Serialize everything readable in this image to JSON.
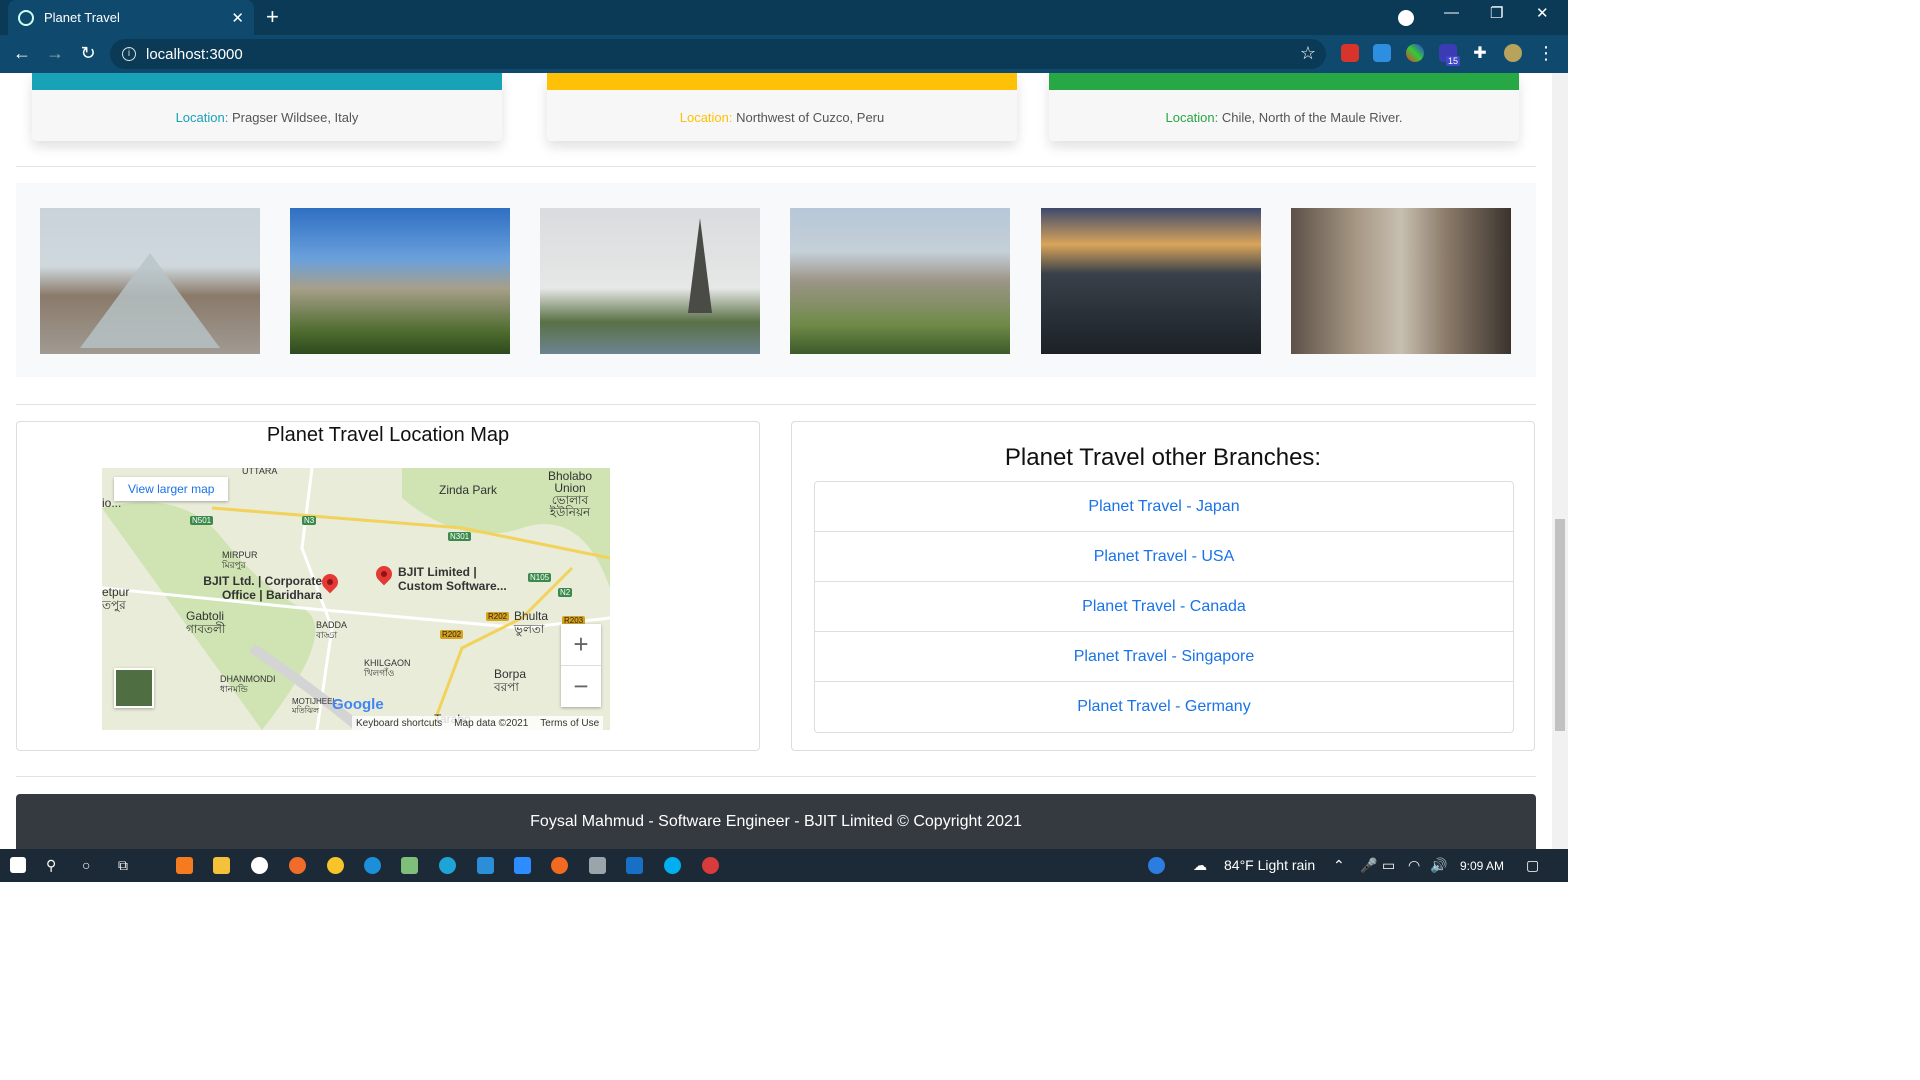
{
  "browser": {
    "tab_title": "Planet Travel",
    "tab_close": "✕",
    "new_tab": "+",
    "url": "localhost:3000",
    "win_min": "—",
    "win_max": "❐",
    "win_close": "✕",
    "ext_badge": "15"
  },
  "locations": [
    {
      "label": "Location:",
      "value": "Pragser Wildsee, Italy",
      "color": "#17a2b8"
    },
    {
      "label": "Location:",
      "value": "Northwest of Cuzco, Peru",
      "color": "#ffc107"
    },
    {
      "label": "Location:",
      "value": "Chile, North of the Maule River.",
      "color": "#28a745"
    }
  ],
  "gallery": [
    {
      "icon": "louvre-photo"
    },
    {
      "icon": "notre-dame-photo"
    },
    {
      "icon": "eiffel-tower-photo"
    },
    {
      "icon": "paris-aerial-photo"
    },
    {
      "icon": "city-night-photo"
    },
    {
      "icon": "paris-street-photo"
    }
  ],
  "map_panel": {
    "title": "Planet Travel Location Map",
    "view_larger": "View larger map",
    "labels": {
      "uttara": "UTTARA",
      "zinda_park": "Zinda Park",
      "bholabo": "Bholabo Union ভোলাব ইউনিয়ন",
      "mirpur": "MIRPUR মিরপুর",
      "bjit_corp": "BJIT Ltd. | Corporate Office | Baridhara",
      "bjit_ltd": "BJIT Limited | Custom Software...",
      "gabtoli": "Gabtoli গাবতলী",
      "badda": "BADDA বাড্ডা",
      "bhulta": "Bhulta ভুলতা",
      "khilgaon": "KHILGAON খিলগাঁও",
      "dhanmondi": "DHANMONDI ধানমন্ডি",
      "motijheel": "MOTIJHEEL মতিঝিল",
      "borpa": "Borpa বরপা",
      "tarabo": "Tarabo",
      "etpur": "etpur তপুর",
      "io": "io..."
    },
    "roads": [
      "N501",
      "N3",
      "N301",
      "N105",
      "N2",
      "R202",
      "R202",
      "R203"
    ],
    "google": "Google",
    "zoom_in": "+",
    "zoom_out": "−",
    "footer": [
      "Keyboard shortcuts",
      "Map data ©2021",
      "Terms of Use"
    ]
  },
  "branches": {
    "title": "Planet Travel other Branches:",
    "items": [
      "Planet Travel - Japan",
      "Planet Travel - USA",
      "Planet Travel - Canada",
      "Planet Travel - Singapore",
      "Planet Travel - Germany"
    ]
  },
  "footer": {
    "text": "Foysal Mahmud - Software Engineer - BJIT Limited © Copyright 2021"
  },
  "taskbar": {
    "weather": "84°F  Light rain",
    "time": "9:09 AM"
  }
}
